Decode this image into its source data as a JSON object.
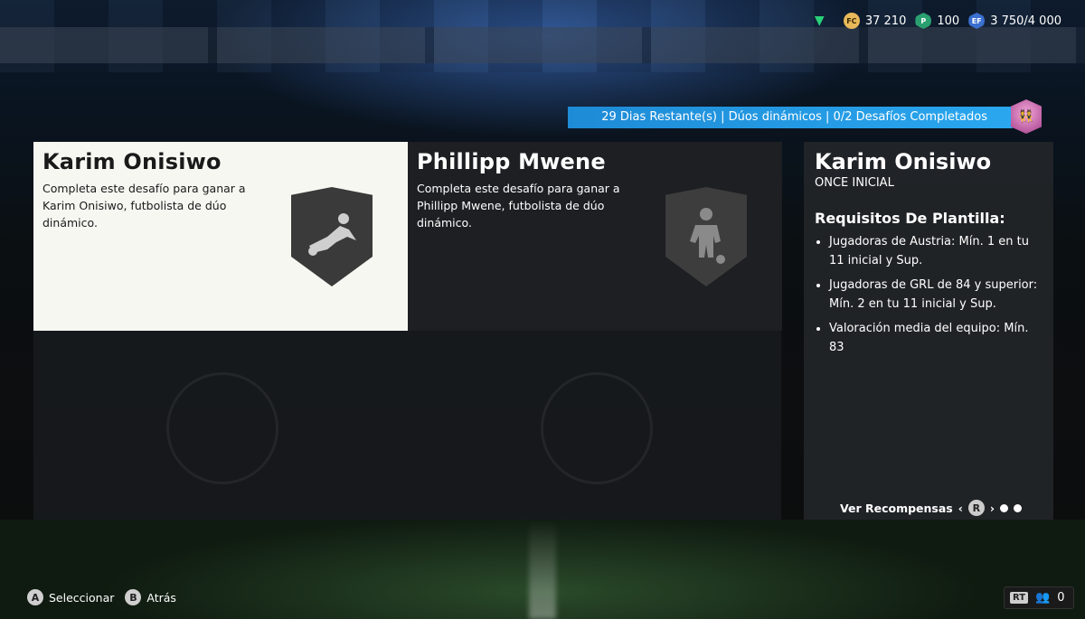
{
  "topbar": {
    "coins": "37 210",
    "points": "100",
    "ef": "3 750/4 000"
  },
  "banner": {
    "text": "29 Dias Restante(s) | Dúos dinámicos | 0/2 Desafíos Completados"
  },
  "cards": [
    {
      "title": "Karim Onisiwo",
      "desc": "Completa este desafío para ganar a Karim Onisiwo, futbolista de dúo dinámico."
    },
    {
      "title": "Phillipp Mwene",
      "desc": "Completa este desafío para ganar a Phillipp Mwene, futbolista de dúo dinámico."
    }
  ],
  "details": {
    "title": "Karim Onisiwo",
    "subtitle": "ONCE INICIAL",
    "req_heading": "Requisitos De Plantilla:",
    "requirements": [
      "Jugadoras de Austria: Mín. 1 en tu 11 inicial y Sup.",
      "Jugadoras de GRL de 84 y superior: Mín. 2 en tu 11 inicial y Sup.",
      "Valoración media del equipo: Mín. 83"
    ],
    "rewards_label": "Ver Recompensas",
    "rewards_btn": "R"
  },
  "controls": {
    "a_btn": "A",
    "select": "Seleccionar",
    "b_btn": "B",
    "back": "Atrás"
  },
  "corner": {
    "rt": "RT",
    "count": "0"
  },
  "colors": {
    "banner": "#2aa7ef",
    "selected_card": "#f7f7f2"
  }
}
